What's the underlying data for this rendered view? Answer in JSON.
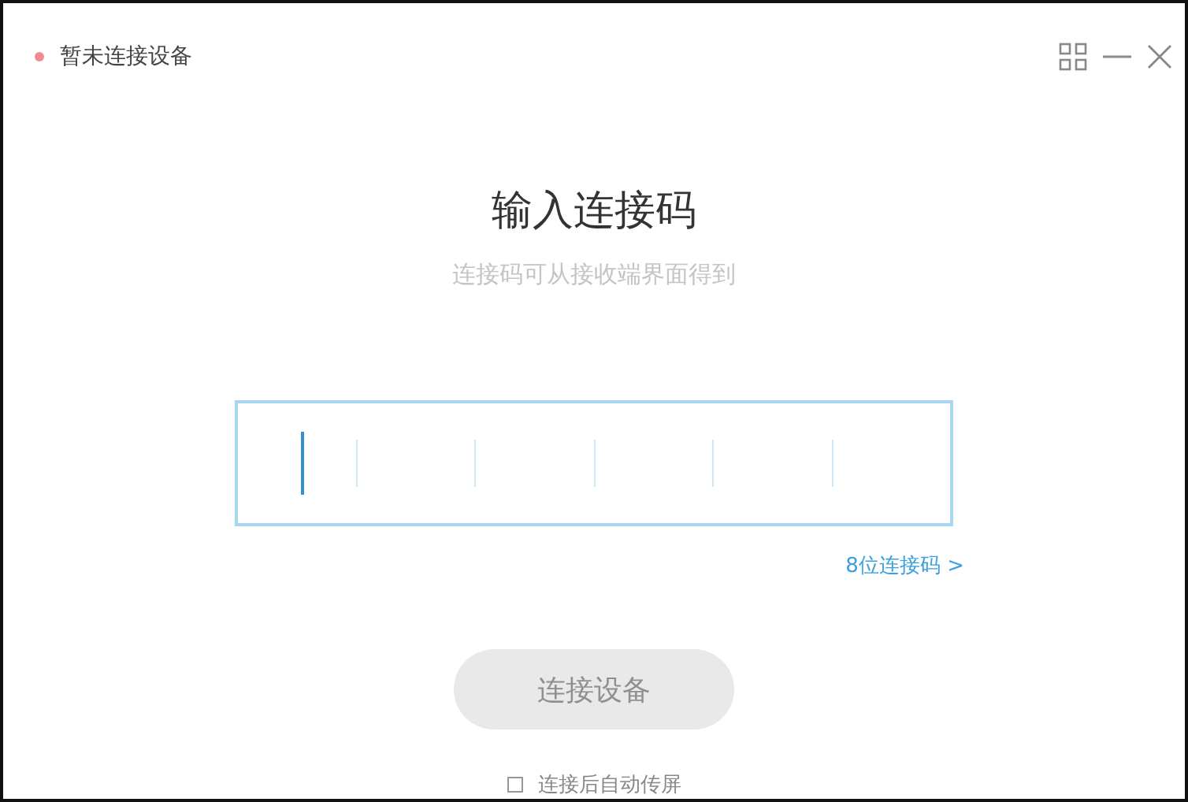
{
  "status": {
    "text": "暂未连接设备",
    "connected": false
  },
  "window_controls": [
    {
      "kind": "grid"
    },
    {
      "kind": "minimize"
    },
    {
      "kind": "close"
    }
  ],
  "title": "输入连接码",
  "subtitle": "连接码可从接收端界面得到",
  "code_field": {
    "focused": true
  },
  "switch_link": {
    "text": "8位连接码",
    "arrow": ">"
  },
  "connect_button": {
    "label": "连接设备",
    "disabled": true
  },
  "auto_share": {
    "label": "连接后自动传屏",
    "checked": false
  }
}
